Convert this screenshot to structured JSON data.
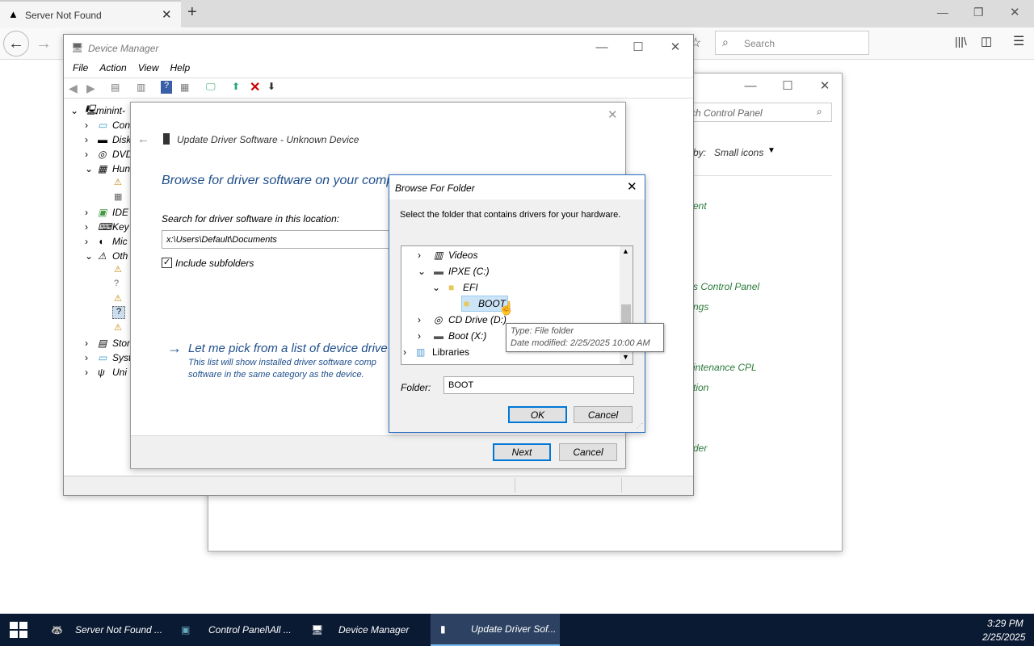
{
  "browser": {
    "tab_title": "Server Not Found",
    "search_placeholder": "Search"
  },
  "control_panel": {
    "search_placeholder": "rch Control Panel",
    "view_by_label": "by:",
    "view_by_value": "Small icons",
    "items": [
      "ent",
      "s Control Panel",
      "ngs",
      "intenance CPL",
      "tion",
      "der"
    ]
  },
  "device_manager": {
    "title": "Device Manager",
    "menu": [
      "File",
      "Action",
      "View",
      "Help"
    ],
    "tree_root": "minint-",
    "tree_items": [
      "Con",
      "Disk",
      "DVD",
      "Hun",
      "IDE",
      "Key",
      "Mic",
      "Oth",
      "Stor",
      "Syst",
      "Uni"
    ]
  },
  "update_driver": {
    "title": "Update Driver Software - Unknown Device",
    "heading": "Browse for driver software on your comp",
    "search_label": "Search for driver software in this location:",
    "path_value": "x:\\Users\\Default\\Documents",
    "include_subfolders": "Include subfolders",
    "pick_link": "Let me pick from a list of device drive",
    "pick_desc_1": "This list will show installed driver software comp",
    "pick_desc_2": "software in the same category as the device.",
    "next_label": "Next",
    "cancel_label": "Cancel"
  },
  "browse_folder": {
    "title": "Browse For Folder",
    "instruction": "Select the folder that contains drivers for your hardware.",
    "tree": {
      "videos": "Videos",
      "ipxe": "IPXE (C:)",
      "efi": "EFI",
      "boot": "BOOT",
      "cd_drive": "CD Drive (D:)",
      "boot_x": "Boot (X:)",
      "libraries": "Libraries"
    },
    "tooltip_type": "Type: File folder",
    "tooltip_modified": "Date modified: 2/25/2025 10:00 AM",
    "folder_label": "Folder:",
    "folder_value": "BOOT",
    "ok_label": "OK",
    "cancel_label": "Cancel"
  },
  "taskbar": {
    "items": [
      "Server Not Found ...",
      "Control Panel\\All ...",
      "Device Manager",
      "Update Driver Sof..."
    ],
    "time": "3:29 PM",
    "date": "2/25/2025"
  }
}
